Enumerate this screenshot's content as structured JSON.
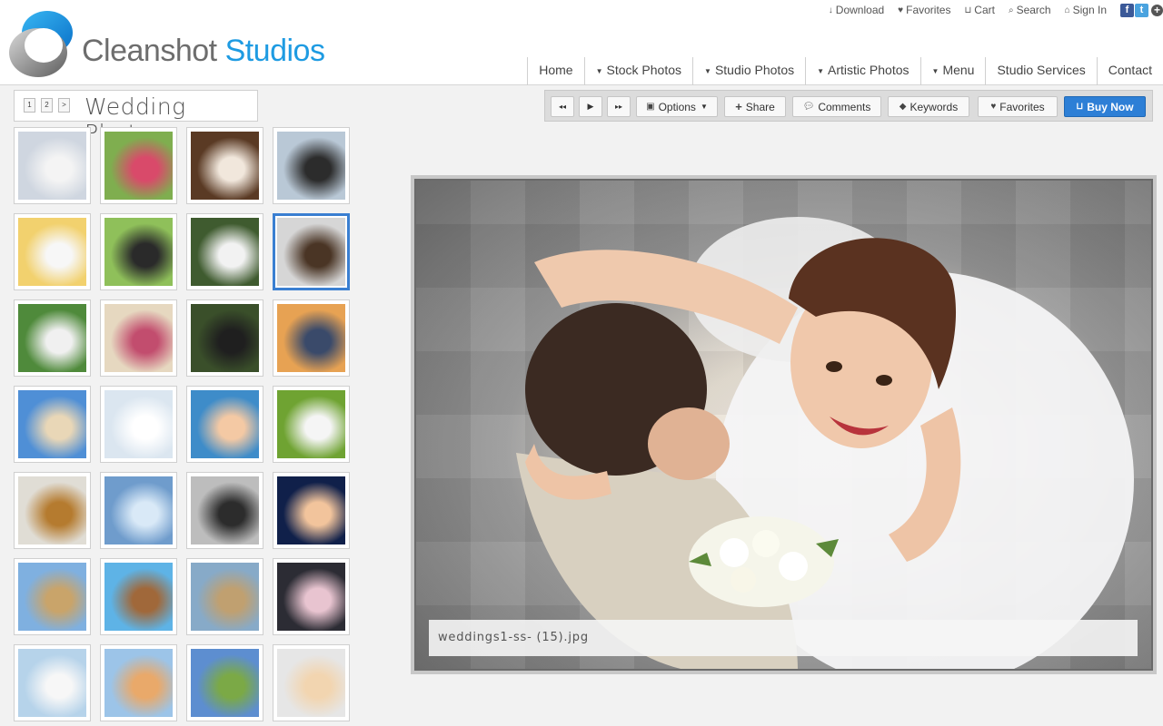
{
  "brand": {
    "word1": "Cleanshot",
    "word2": "Studios"
  },
  "utility": [
    {
      "label": "Download",
      "icon": "download-icon",
      "glyph": "↓"
    },
    {
      "label": "Favorites",
      "icon": "heart-icon",
      "glyph": "♥"
    },
    {
      "label": "Cart",
      "icon": "cart-icon",
      "glyph": "⊔"
    },
    {
      "label": "Search",
      "icon": "search-icon",
      "glyph": "⌕"
    },
    {
      "label": "Sign In",
      "icon": "home-icon",
      "glyph": "⌂"
    }
  ],
  "nav": [
    {
      "label": "Home",
      "dropdown": false
    },
    {
      "label": "Stock Photos",
      "dropdown": true
    },
    {
      "label": "Studio Photos",
      "dropdown": true
    },
    {
      "label": "Artistic Photos",
      "dropdown": true
    },
    {
      "label": "Menu",
      "dropdown": true
    },
    {
      "label": "Studio Services",
      "dropdown": false
    },
    {
      "label": "Contact",
      "dropdown": false
    }
  ],
  "gallery": {
    "title": "Wedding Photos",
    "pages": [
      "1",
      "2",
      ">"
    ]
  },
  "toolbar": {
    "prev_glyph": "◂◂",
    "play_glyph": "▶",
    "next_glyph": "▸▸",
    "options": "Options",
    "share": "Share",
    "comments": "Comments",
    "keywords": "Keywords",
    "favorites": "Favorites",
    "buy": "Buy Now"
  },
  "thumbnails": {
    "selected_index": 7,
    "count": 28,
    "palette": [
      [
        "#cfd6e0",
        "#f4f4f4"
      ],
      [
        "#7fae4f",
        "#d94a6a"
      ],
      [
        "#5a3a24",
        "#f1e7dc"
      ],
      [
        "#b9c8d6",
        "#2c2c2c"
      ],
      [
        "#f2d16e",
        "#f7f7f7"
      ],
      [
        "#8fc05a",
        "#2a2a2a"
      ],
      [
        "#3f5b2f",
        "#f2f2f2"
      ],
      [
        "#d6d6d6",
        "#4a3525"
      ],
      [
        "#4f8a3b",
        "#f0f0f0"
      ],
      [
        "#e6d8c0",
        "#c24d6e"
      ],
      [
        "#3a4f2a",
        "#1f1f1f"
      ],
      [
        "#e7a253",
        "#3a4a6a"
      ],
      [
        "#4f8fd6",
        "#e9d7b7"
      ],
      [
        "#dbe6f0",
        "#ffffff"
      ],
      [
        "#3e8cc9",
        "#f4c9a4"
      ],
      [
        "#6fa332",
        "#f5f5f5"
      ],
      [
        "#e0ddd5",
        "#b57b2f"
      ],
      [
        "#6f9ccc",
        "#d9e9f7"
      ],
      [
        "#bdbdbd",
        "#2c2c2c"
      ],
      [
        "#10204a",
        "#f2c49c"
      ],
      [
        "#7fb0e0",
        "#c9a46a"
      ],
      [
        "#5eb3e6",
        "#a0683a"
      ],
      [
        "#87aac8",
        "#c0a070"
      ],
      [
        "#2c2c34",
        "#e8c4d0"
      ],
      [
        "#b6d3ea",
        "#f7f7f7"
      ],
      [
        "#9cc4e8",
        "#e9a96a"
      ],
      [
        "#5d8ed0",
        "#7ba946"
      ],
      [
        "#e6e6e6",
        "#f2d5b0"
      ]
    ]
  },
  "viewer": {
    "caption": "weddings1-ss- (15).jpg"
  }
}
